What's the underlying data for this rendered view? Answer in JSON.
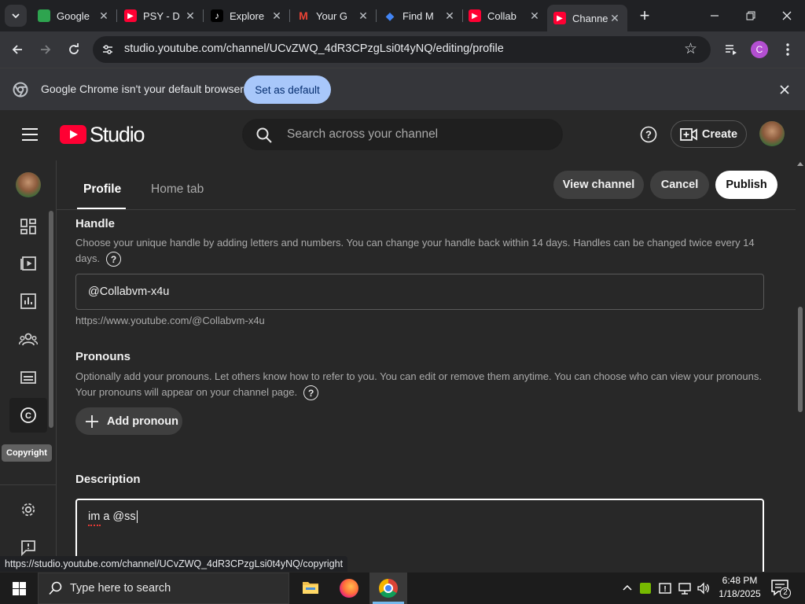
{
  "browser": {
    "tabs": [
      {
        "title": "Google",
        "favicon_color": "#2ea44f",
        "active": false
      },
      {
        "title": "PSY - D",
        "favicon_color": "#ff0033",
        "active": false
      },
      {
        "title": "Explore",
        "favicon_color": "#000000",
        "active": false
      },
      {
        "title": "Your G",
        "favicon_color": "#ea4335",
        "active": false
      },
      {
        "title": "Find M",
        "favicon_color": "#1e88e5",
        "active": false
      },
      {
        "title": "Collab",
        "favicon_color": "#ff0033",
        "active": false
      },
      {
        "title": "Channe",
        "favicon_color": "#ff0033",
        "active": true
      }
    ],
    "new_tab_label": "+",
    "url": "studio.youtube.com/channel/UCvZWQ_4dR3CPzgLsi0t4yNQ/editing/profile",
    "profile_initial": "C",
    "profile_color": "#b34fd1"
  },
  "infobar": {
    "message": "Google Chrome isn't your default browser",
    "button": "Set as default"
  },
  "studio": {
    "logo_text": "Studio",
    "search_placeholder": "Search across your channel",
    "create_label": "Create",
    "tabs": [
      {
        "label": "Profile",
        "active": true
      },
      {
        "label": "Home tab",
        "active": false
      }
    ],
    "actions": {
      "view_channel": "View channel",
      "cancel": "Cancel",
      "publish": "Publish"
    },
    "nav_tooltip": "Copyright",
    "handle": {
      "title": "Handle",
      "help": "Choose your unique handle by adding letters and numbers. You can change your handle back within 14 days. Handles can be changed twice every 14 days.",
      "value": "@Collabvm-x4u",
      "url": "https://www.youtube.com/@Collabvm-x4u"
    },
    "pronouns": {
      "title": "Pronouns",
      "help": "Optionally add your pronouns. Let others know how to refer to you. You can edit or remove them anytime. You can choose who can view your pronouns. Your pronouns will appear on your channel page.",
      "button": "Add pronoun"
    },
    "description": {
      "title": "Description",
      "value": "im a @ss"
    }
  },
  "statusbar": {
    "link": "https://studio.youtube.com/channel/UCvZWQ_4dR3CPzgLsi0t4yNQ/copyright"
  },
  "taskbar": {
    "search_placeholder": "Type here to search",
    "time": "6:48 PM",
    "date": "1/18/2025",
    "notification_count": "2"
  }
}
